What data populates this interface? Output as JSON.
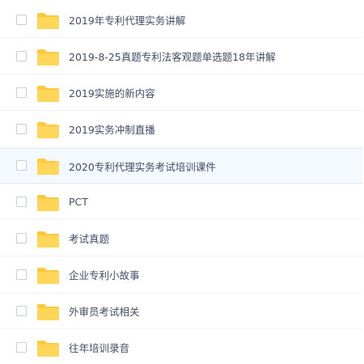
{
  "file_list": {
    "items": [
      {
        "name": "2019年专利代理实务讲解",
        "icon": "folder-icon"
      },
      {
        "name": "2019-8-25真题专利法客观题单选题18年讲解",
        "icon": "folder-icon"
      },
      {
        "name": "2019实施的新内容",
        "icon": "folder-icon"
      },
      {
        "name": "2019实务冲制直播",
        "icon": "folder-icon"
      },
      {
        "name": "2020专利代理实务考试培训课件",
        "icon": "folder-icon"
      },
      {
        "name": "PCT",
        "icon": "folder-icon"
      },
      {
        "name": "考试真题",
        "icon": "folder-icon"
      },
      {
        "name": "企业专利小故事",
        "icon": "folder-icon"
      },
      {
        "name": "外审员考试相关",
        "icon": "folder-icon"
      },
      {
        "name": "往年培训录音",
        "icon": "folder-icon"
      }
    ]
  },
  "colors": {
    "folder_fill": "#ffd659",
    "folder_tab": "#ffc83d",
    "text": "#424e67",
    "row_highlight": "#f4f8ff"
  }
}
